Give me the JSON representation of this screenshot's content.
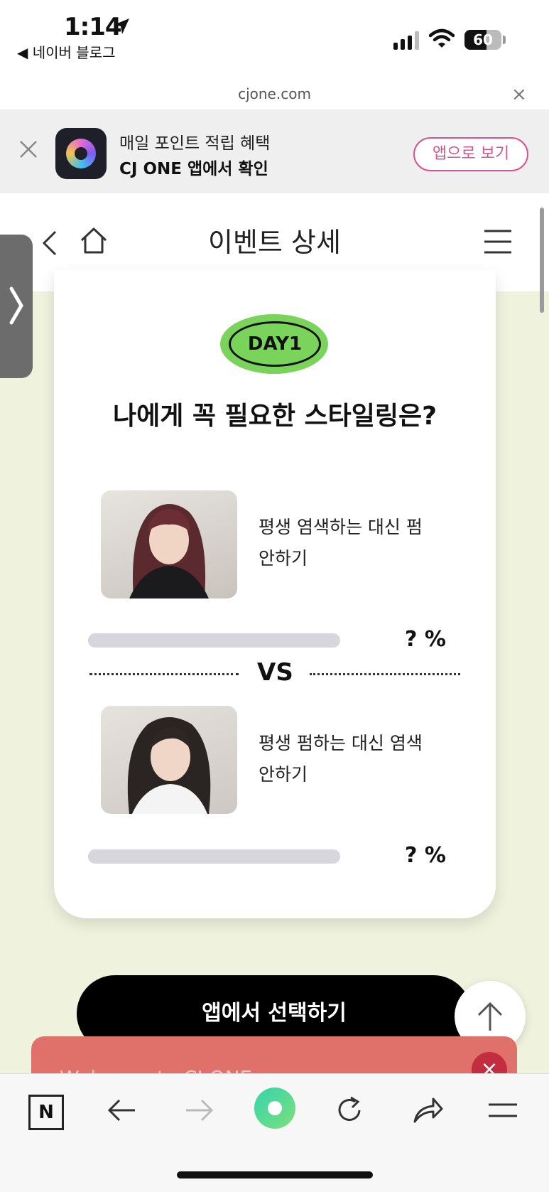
{
  "status_bar": {
    "time": "1:14",
    "back_app": "◀ 네이버 블로그",
    "battery": "60"
  },
  "url_bar": {
    "domain": "cjone.com",
    "close": "×"
  },
  "app_banner": {
    "line1": "매일 포인트 적립 혜택",
    "line2": "CJ ONE 앱에서 확인",
    "button": "앱으로 보기"
  },
  "header": {
    "title": "이벤트 상세"
  },
  "event": {
    "badge": "DAY1",
    "question": "나에게 꼭 필요한 스타일링은?",
    "options": [
      {
        "text": "평생 염색하는 대신 펌 안하기",
        "percent": "? %"
      },
      {
        "text": "평생 펌하는 대신 염색 안하기",
        "percent": "? %"
      }
    ],
    "vs": "VS"
  },
  "cta": {
    "label": "앱에서 선택하기"
  },
  "promo": {
    "text": "Welcome to CJ ONE",
    "close": "×"
  },
  "toolbar": {
    "n_label": "N"
  },
  "colors": {
    "accent_pink": "#d9548d",
    "badge_green": "#7ad35a",
    "content_bg": "#eff3dd",
    "promo_red": "#e0716a"
  },
  "icons": [
    "location-arrow-icon",
    "signal-icon",
    "wifi-icon",
    "battery-icon",
    "close-icon",
    "cjone-app-icon",
    "back-chevron-icon",
    "home-icon",
    "hamburger-menu-icon",
    "side-tab-chevron-icon",
    "arrow-up-icon",
    "naver-n-icon",
    "arrow-left-icon",
    "arrow-right-icon",
    "naver-home-icon",
    "reload-icon",
    "share-icon",
    "menu-icon"
  ]
}
